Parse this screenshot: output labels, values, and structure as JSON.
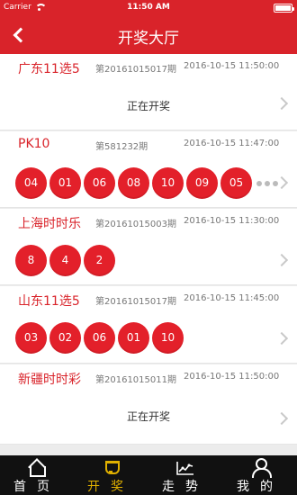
{
  "status": {
    "carrier": "Carrier",
    "time": "11:50 AM"
  },
  "header": {
    "title": "开奖大厅"
  },
  "lotteries": [
    {
      "name": "广东11选5",
      "issue": "第20161015017期",
      "time": "2016-10-15 11:50:00",
      "status": "正在开奖",
      "balls": []
    },
    {
      "name": "PK10",
      "issue": "第581232期",
      "time": "2016-10-15 11:47:00",
      "status": "",
      "balls": [
        "04",
        "01",
        "06",
        "08",
        "10",
        "09",
        "05"
      ]
    },
    {
      "name": "上海时时乐",
      "issue": "第20161015003期",
      "time": "2016-10-15 11:30:00",
      "status": "",
      "balls": [
        "8",
        "4",
        "2"
      ]
    },
    {
      "name": "山东11选5",
      "issue": "第20161015017期",
      "time": "2016-10-15 11:45:00",
      "status": "",
      "balls": [
        "03",
        "02",
        "06",
        "01",
        "10"
      ]
    },
    {
      "name": "新疆时时彩",
      "issue": "第20161015011期",
      "time": "2016-10-15 11:50:00",
      "status": "正在开奖",
      "balls": []
    }
  ],
  "tabbar": {
    "tabs": [
      {
        "label": "首页",
        "icon": "home-icon"
      },
      {
        "label": "开奖",
        "icon": "trophy-icon",
        "active": true
      },
      {
        "label": "走势",
        "icon": "trend-icon"
      },
      {
        "label": "我的",
        "icon": "user-icon"
      }
    ]
  },
  "colors": {
    "brand": "#d9232a",
    "active": "#e0b000"
  }
}
